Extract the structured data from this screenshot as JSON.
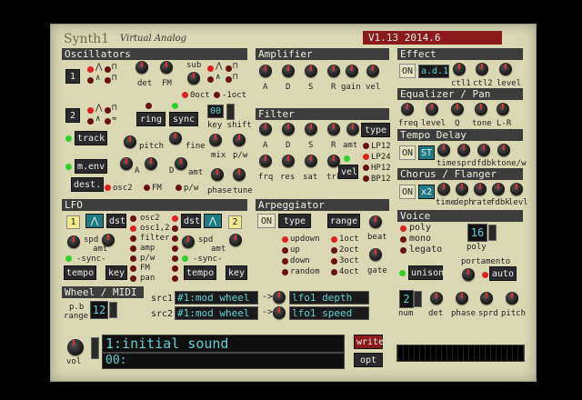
{
  "app": {
    "name": "Synth1",
    "subtitle": "Virtual Analog",
    "version": "V1.13 2014.6",
    "version_color": "#8b1a1a"
  },
  "osc": {
    "header": "Oscillators",
    "osc1": "1",
    "osc2": "2",
    "sub": "sub",
    "det": "det",
    "fm": "FM",
    "oct0": "0oct",
    "oct1": "-1oct",
    "ring": "ring",
    "sync": "sync",
    "track": "track",
    "pitch": "pitch",
    "fine": "fine",
    "menv": "m.env",
    "dest": "dest.",
    "a": "A",
    "d": "D",
    "amt": "amt",
    "osc2d": "osc2",
    "fmd": "FM",
    "pw": "p/w",
    "key_shift": "key shift",
    "mix": "mix",
    "pwk": "p/w",
    "phase": "phase",
    "tune": "tune",
    "shift_val": "00"
  },
  "amp": {
    "header": "Amplifier",
    "a": "A",
    "d": "D",
    "s": "S",
    "r": "R",
    "gain": "gain",
    "vel": "vel"
  },
  "filter": {
    "header": "Filter",
    "a": "A",
    "d": "D",
    "s": "S",
    "r": "R",
    "amt": "amt",
    "type": "type",
    "frq": "frq",
    "res": "res",
    "sat": "sat",
    "trk": "trk",
    "vel": "vel",
    "types": [
      "LP12",
      "LP24",
      "HP12",
      "BP12"
    ]
  },
  "lfo": {
    "header": "LFO",
    "l1": "1",
    "l2": "2",
    "dst": "dst",
    "dests": [
      "osc2",
      "osc1,2",
      "filter",
      "amp",
      "p/w",
      "FM",
      "pan"
    ],
    "spd": "spd",
    "amt": "amt",
    "sync": "-sync-",
    "tempo": "tempo",
    "key": "key"
  },
  "arp": {
    "header": "Arpeggiator",
    "on": "ON",
    "type": "type",
    "range": "range",
    "types": [
      "updown",
      "up",
      "down",
      "random"
    ],
    "ranges": [
      "1oct",
      "2oct",
      "3oct",
      "4oct"
    ],
    "beat": "beat",
    "gate": "gate"
  },
  "effect": {
    "header": "Effect",
    "on": "ON",
    "name": "a.d.1",
    "ctl1": "ctl1",
    "ctl2": "ctl2",
    "level": "level"
  },
  "eq": {
    "header": "Equalizer / Pan",
    "freq": "freq",
    "level": "level",
    "q": "Q",
    "tone": "tone",
    "lr": "L-R"
  },
  "delay": {
    "header": "Tempo Delay",
    "on": "ON",
    "st": "ST",
    "time": "time",
    "sprd": "sprd",
    "fdbk": "fdbk",
    "tonew": "tone/w"
  },
  "chorus": {
    "header": "Chorus / Flanger",
    "on": "ON",
    "x2": "x2",
    "time": "time",
    "deph": "deph",
    "rate": "rate",
    "fdbk": "fdbk",
    "levl": "levl"
  },
  "voice": {
    "header": "Voice",
    "modes": [
      "poly",
      "mono",
      "legato"
    ],
    "poly_count": "16",
    "poly": "poly",
    "unison": "unison",
    "portamento": "portamento",
    "auto": "auto",
    "num_val": "2",
    "num": "num",
    "det": "det",
    "phase": "phase",
    "sprd": "sprd",
    "pitch": "pitch"
  },
  "midi": {
    "header": "Wheel / MIDI",
    "pb": "p.b",
    "range": "range",
    "range_val": "12",
    "src1": "src1",
    "src2": "src2",
    "src1_val": "#1:mod wheel",
    "src2_val": "#1:mod wheel",
    "dst1": "lfo1 depth",
    "dst2": "lfo1 speed"
  },
  "patch": {
    "vol": "vol",
    "name": "1:initial sound",
    "bank": "00:",
    "write": "write",
    "opt": "opt"
  }
}
